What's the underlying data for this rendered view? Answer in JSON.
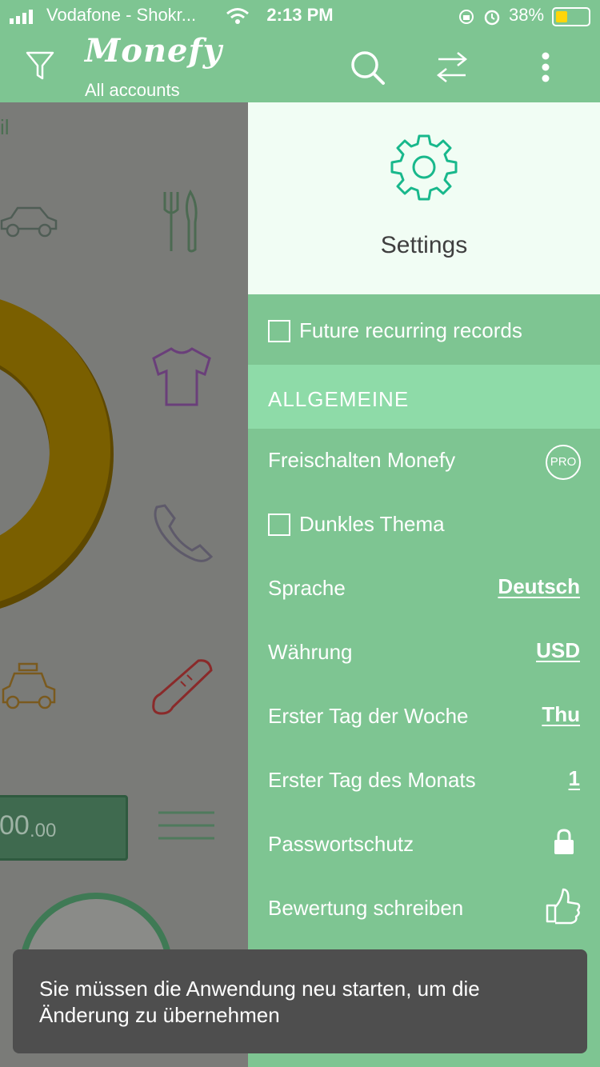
{
  "status_bar": {
    "carrier": "Vodafone - Shokr...",
    "time": "2:13 PM",
    "battery_percent": "38%",
    "battery_level": 0.38
  },
  "header": {
    "app_name": "Monefy",
    "subtitle": "All accounts"
  },
  "background": {
    "partial_text": "il",
    "amount_main": "00",
    "amount_decimal": ".00"
  },
  "drawer": {
    "title": "Settings",
    "future_records_label": "Future recurring records",
    "section_title": "ALLGEMEINE",
    "items": [
      {
        "label": "Freischalten Monefy",
        "badge": "PRO"
      },
      {
        "label": "Dunkles Thema"
      },
      {
        "label": "Sprache",
        "value": "Deutsch"
      },
      {
        "label": "Währung",
        "value": "USD"
      },
      {
        "label": "Erster Tag der Woche",
        "value": "Thu"
      },
      {
        "label": "Erster Tag des Monats",
        "value": "1"
      },
      {
        "label": "Passwortschutz"
      },
      {
        "label": "Bewertung schreiben"
      }
    ]
  },
  "toast": {
    "message": "Sie müssen die Anwendung neu starten, um die Änderung zu übernehmen"
  },
  "colors": {
    "primary_green": "#7ec592",
    "section_green": "#8edba8",
    "gear_teal": "#19b88c",
    "donut_gold": "#7a5f00"
  }
}
